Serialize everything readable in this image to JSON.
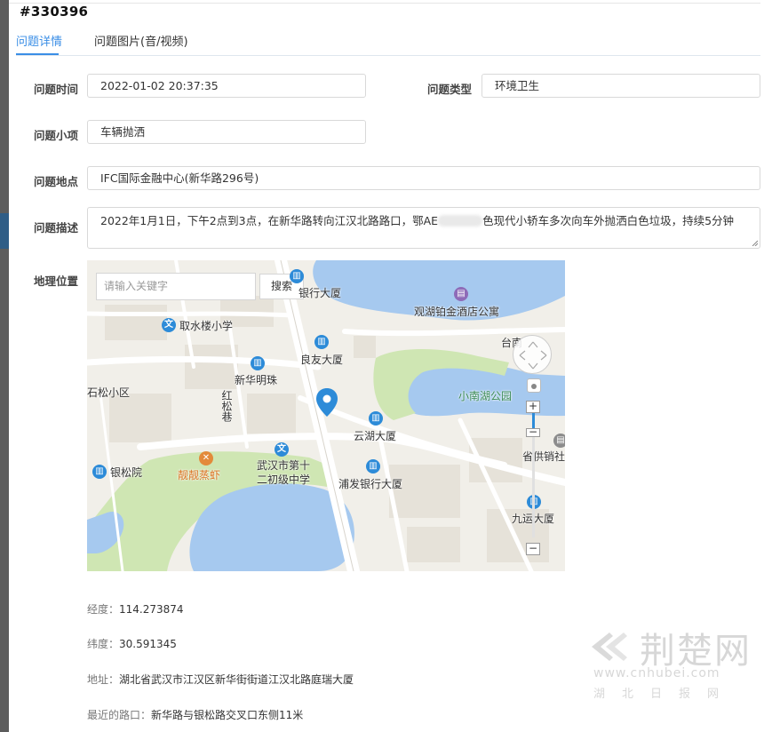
{
  "header": {
    "id": "#330396"
  },
  "tabs": [
    {
      "label": "问题详情",
      "active": true
    },
    {
      "label": "问题图片(音/视频)",
      "active": false
    }
  ],
  "form": {
    "time_label": "问题时间",
    "time_value": "2022-01-02 20:37:35",
    "type_label": "问题类型",
    "type_value": "环境卫生",
    "subitem_label": "问题小项",
    "subitem_value": "车辆抛洒",
    "location_label": "问题地点",
    "location_value": "IFC国际金融中心(新华路296号)",
    "desc_label": "问题描述",
    "desc_prefix": "2022年1月1日，下午2点到3点，在新华路转向江汉北路路口，鄂AE",
    "desc_suffix": "色现代小轿车多次向车外抛洒白色垃圾，持续5分钟",
    "geo_label": "地理位置"
  },
  "map": {
    "search_placeholder": "请输入关键字",
    "search_button": "搜索",
    "zoom_in": "+",
    "zoom_out": "−",
    "pois": {
      "bank_building": "银行大厦",
      "hotel": "观湖铂金酒店公寓",
      "school_1": "取水楼小学",
      "liangyou": "良友大厦",
      "tainan": "台南",
      "xinhua": "新华明珠",
      "park": "小南湖公园",
      "songxiaoqu": "石松小区",
      "hongsongxiang": "红松巷",
      "yunhu": "云湖大厦",
      "jiuzhou": "九运大厦",
      "post": "省供销社",
      "yinsong": "银松院",
      "shrimp": "靓靓蒸虾",
      "school_2": "武汉市第十二初级中学",
      "spdb": "浦发银行大厦"
    }
  },
  "info": {
    "lng_label": "经度：",
    "lng_value": "114.273874",
    "lat_label": "纬度：",
    "lat_value": "30.591345",
    "addr_label": "地址：",
    "addr_value": "湖北省武汉市江汉区新华街街道江汉北路庭瑞大厦",
    "cross_label": "最近的路口：",
    "cross_value": "新华路与银松路交叉口东侧11米"
  },
  "watermark": {
    "brand": "荆楚网",
    "url": "www.cnhubei.com",
    "sub": "湖北日报网"
  },
  "colors": {
    "accent": "#3a8ee6",
    "water": "#a6c9ef",
    "park": "#cfe6b3",
    "road_major": "#ffffff",
    "marker": "#2d8bd8"
  }
}
